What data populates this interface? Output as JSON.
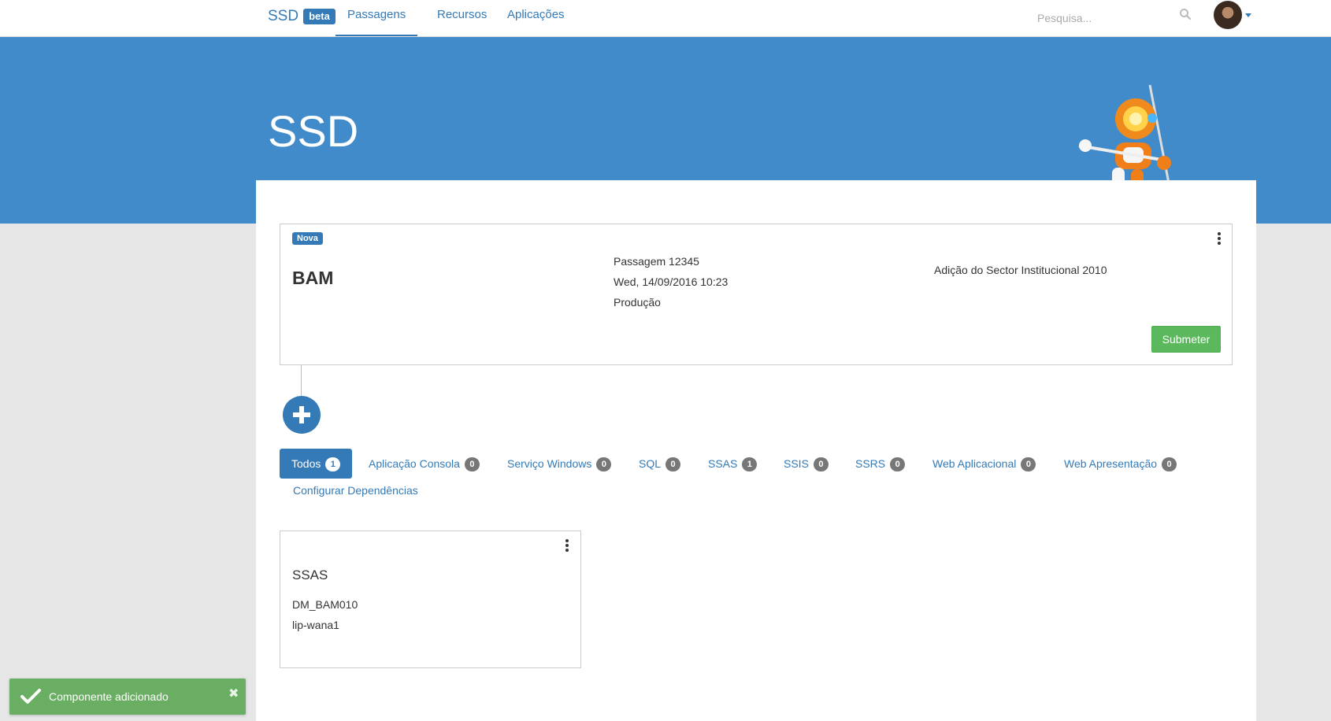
{
  "navbar": {
    "brand": "SSD",
    "brand_badge": "beta",
    "links": [
      "Passagens",
      "Recursos",
      "Aplicações"
    ],
    "active_link": "Passagens",
    "search_placeholder": "Pesquisa..."
  },
  "hero": {
    "title": "SSD"
  },
  "passagem": {
    "status_label": "Nova",
    "application": "BAM",
    "number": "Passagem 12345",
    "datetime": "Wed, 14/09/2016 10:23",
    "environment": "Produção",
    "description": "Adição do Sector Institucional 2010",
    "submit_label": "Submeter"
  },
  "tabs": [
    {
      "label": "Todos",
      "count": "1",
      "active": true
    },
    {
      "label": "Aplicação Consola",
      "count": "0"
    },
    {
      "label": "Serviço Windows",
      "count": "0"
    },
    {
      "label": "SQL",
      "count": "0"
    },
    {
      "label": "SSAS",
      "count": "1"
    },
    {
      "label": "SSIS",
      "count": "0"
    },
    {
      "label": "SSRS",
      "count": "0"
    },
    {
      "label": "Web Aplicacional",
      "count": "0"
    },
    {
      "label": "Web Apresentação",
      "count": "0"
    }
  ],
  "config_link": "Configurar Dependências",
  "component": {
    "type": "SSAS",
    "name": "DM_BAM010",
    "server": "lip-wana1"
  },
  "toast": {
    "message": "Componente adicionado",
    "close": "✖"
  },
  "colors": {
    "primary": "#337ab7",
    "hero": "#428bca",
    "success": "#5cb85c",
    "toast": "#6aae63"
  }
}
